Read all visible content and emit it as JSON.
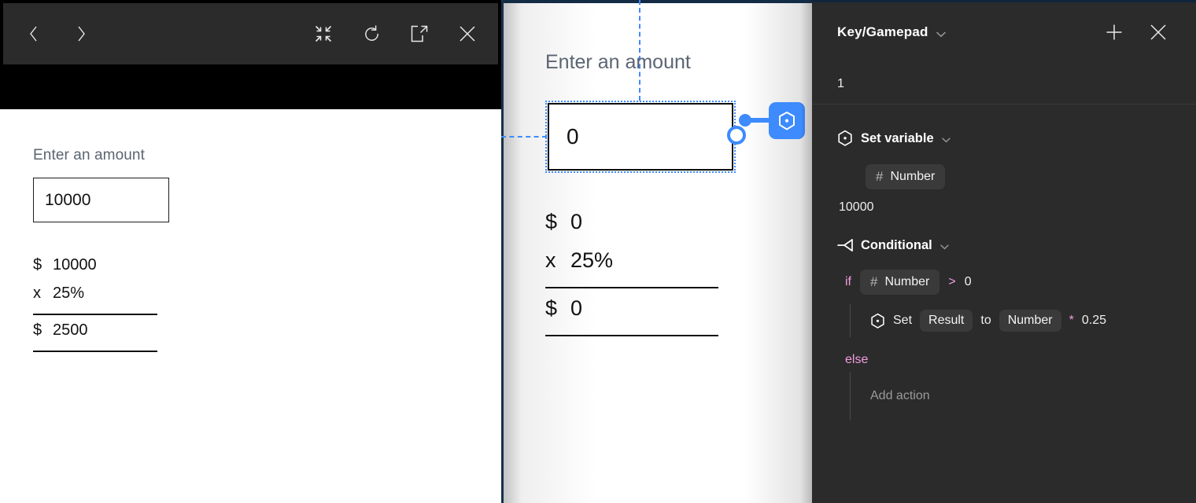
{
  "preview": {
    "toolbar": {
      "back_icon": "chevron-left-icon",
      "forward_icon": "chevron-right-icon",
      "collapse_icon": "collapse-arrows-icon",
      "reload_icon": "reload-icon",
      "open_external_icon": "open-external-icon",
      "close_icon": "close-icon"
    },
    "label": "Enter an amount",
    "input_value": "10000",
    "input_placeholder": "",
    "calc": {
      "rows": [
        {
          "symbol": "$",
          "value": "10000"
        },
        {
          "symbol": "x",
          "value": "25%"
        }
      ],
      "result": {
        "symbol": "$",
        "value": "2500"
      }
    }
  },
  "canvas": {
    "label": "Enter an amount",
    "input_value": "0",
    "badge_icon": "variable-hexagon-icon",
    "calc": {
      "rows": [
        {
          "symbol": "$",
          "value": "0"
        },
        {
          "symbol": "x",
          "value": "25%"
        }
      ],
      "result": {
        "symbol": "$",
        "value": "0"
      }
    }
  },
  "panel": {
    "title": "Key/Gamepad",
    "title_chevron_icon": "chevron-down-icon",
    "add_icon": "plus-icon",
    "close_icon": "close-icon",
    "trigger_key": "1",
    "blocks": [
      {
        "icon": "variable-hexagon-icon",
        "title": "Set variable",
        "chevron_icon": "chevron-down-icon",
        "chip_label": "Number",
        "chip_icon": "hash-icon",
        "value": "10000"
      },
      {
        "icon": "branch-icon",
        "title": "Conditional",
        "chevron_icon": "chevron-down-icon",
        "if_keyword": "if",
        "if_chip_label": "Number",
        "if_chip_icon": "hash-icon",
        "operator": ">",
        "operand": "0",
        "then_action": {
          "icon": "variable-hexagon-icon",
          "verb": "Set",
          "target_chip": "Result",
          "connector": "to",
          "source_chip": "Number",
          "operator": "*",
          "operand": "0.25"
        },
        "else_keyword": "else",
        "else_placeholder": "Add action"
      }
    ]
  },
  "colors": {
    "panel_bg": "#2b2b2b",
    "accent_blue": "#3d8bfd",
    "keyword_pink": "#f39de0",
    "chip_bg": "#3a3a3a"
  }
}
